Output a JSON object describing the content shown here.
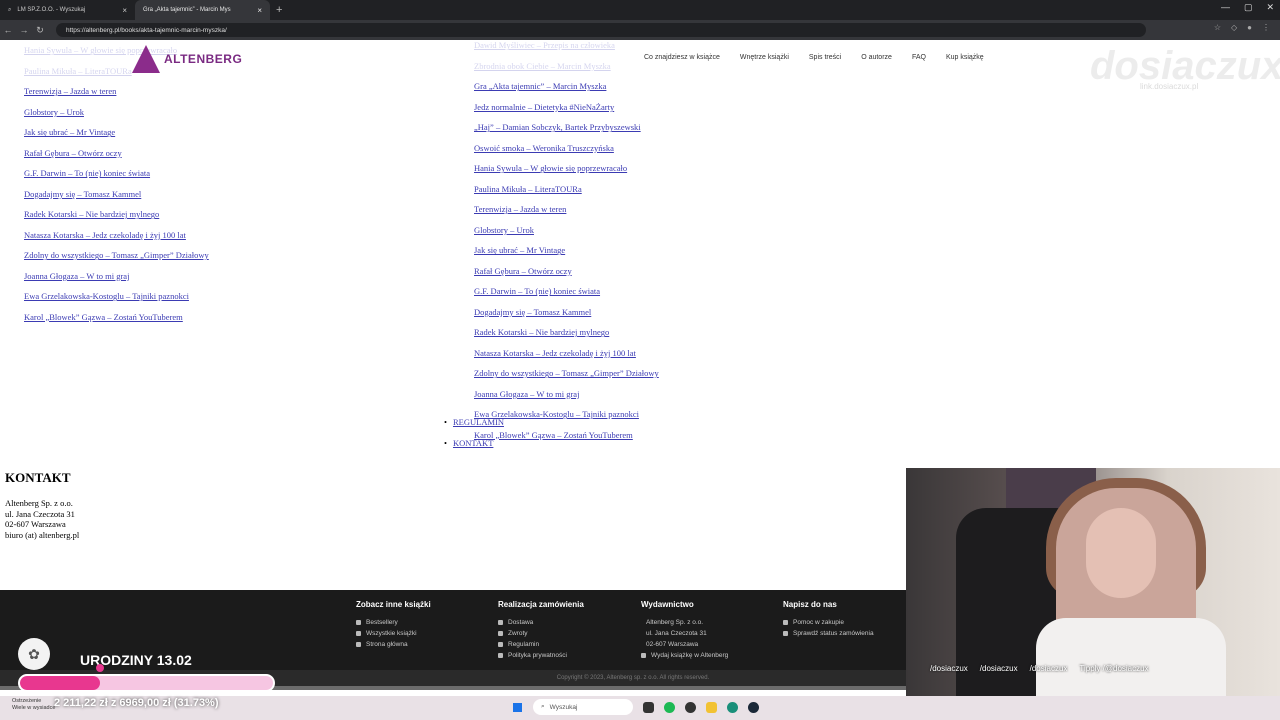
{
  "browser": {
    "tabs": [
      {
        "label": "LM SP.Z.O.O. - Wyszukaj",
        "active": false
      },
      {
        "label": "Gra „Akta tajemnic” - Marcin Mys",
        "active": true
      }
    ],
    "url": "https://altenberg.pl/books/akta-tajemnic-marcin-myszka/"
  },
  "nav": {
    "logo": "ALTENBERG",
    "menu": [
      "Co znajdziesz w książce",
      "Wnętrze książki",
      "Spis treści",
      "O autorze",
      "FAQ",
      "Kup książkę"
    ]
  },
  "watermark": {
    "name": "dosiaczux",
    "line": "link.dosiaczux.pl"
  },
  "left_links": [
    "Hania Sywula – W głowie się poprzewracało",
    "Paulina Mikuła – LiteraTOURa",
    "Terenwizja – Jazda w teren",
    "Globstory – Urok",
    "Jak się ubrać – Mr Vintage",
    "Rafał Gębura – Otwórz oczy",
    "G.F. Darwin – To (nie) koniec świata",
    "Dogadajmy się – Tomasz Kammel",
    "Radek Kotarski – Nie bardziej mylnego",
    "Natasza Kotarska – Jedz czekoladę i żyj 100 lat",
    "Zdolny do wszystkiego – Tomasz „Gimper” Działowy",
    "Joanna Głogaza – W to mi graj",
    "Ewa Grzelakowska-Kostoglu – Tajniki paznokci",
    "Karol „Blowek” Gązwa – Zostań YouTuberem"
  ],
  "right_links": [
    "Dawid Myśliwiec – Przepis na człowieka",
    "Zbrodnia obok Ciebie – Marcin Myszka",
    "Gra „Akta tajemnic” – Marcin Myszka",
    "Jedz normalnie – Dietetyka #NieNaŻarty",
    "„Haj” – Damian Sobczyk, Bartek Przybyszewski",
    "Oswoić smoka – Weronika Truszczyńska",
    "Hania Sywula – W głowie się poprzewracało",
    "Paulina Mikuła – LiteraTOURa",
    "Terenwizja – Jazda w teren",
    "Globstory – Urok",
    "Jak się ubrać – Mr Vintage",
    "Rafał Gębura – Otwórz oczy",
    "G.F. Darwin – To (nie) koniec świata",
    "Dogadajmy się – Tomasz Kammel",
    "Radek Kotarski – Nie bardziej mylnego",
    "Natasza Kotarska – Jedz czekoladę i żyj 100 lat",
    "Zdolny do wszystkiego – Tomasz „Gimper” Działowy",
    "Joanna Głogaza – W to mi graj",
    "Ewa Grzelakowska-Kostoglu – Tajniki paznokci",
    "Karol „Blowek” Gązwa – Zostań YouTuberem"
  ],
  "legal": {
    "regulamin": "REGULAMIN",
    "kontakt": "KONTAKT"
  },
  "kontakt": {
    "title": "KONTAKT",
    "company": "Altenberg Sp. z o.o.",
    "street": "ul. Jana Czeczota 31",
    "city": "02-607 Warszawa",
    "email": "biuro (at) altenberg.pl"
  },
  "footer": {
    "col1": {
      "title": "Zobacz inne książki",
      "items": [
        "Bestsellery",
        "Wszystkie książki",
        "Strona główna"
      ]
    },
    "col2": {
      "title": "Realizacja zamówienia",
      "items": [
        "Dostawa",
        "Zwroty",
        "Regulamin",
        "Polityka prywatności"
      ]
    },
    "col3": {
      "title": "Wydawnictwo",
      "items": [
        "Altenberg Sp. z o.o.",
        "ul. Jana Czeczota 31",
        "02-607 Warszawa",
        "Wydaj książkę w Altenberg"
      ]
    },
    "col4": {
      "title": "Napisz do nas",
      "items": [
        "Pomoc w zakupie",
        "Sprawdź status zamówienia"
      ]
    },
    "copyright": "Copyright © 2023, Altenberg sp. z o.o. All rights reserved."
  },
  "stream": {
    "birthday": "URODZINY 13.02",
    "money": "2 211,22 zł z 6969,00 zł (31.73%)",
    "progress_fraction": 0.3173,
    "pink": "#e8378f",
    "socials": [
      "/dosiaczux",
      "/dosiaczux",
      "/dosiaczux",
      "Tipply /@dosiaczux"
    ]
  },
  "taskbar": {
    "warn_line1": "Ostrzeżenie",
    "warn_line2": "Wiele w wysiadce",
    "search_placeholder": "Wyszukaj"
  }
}
